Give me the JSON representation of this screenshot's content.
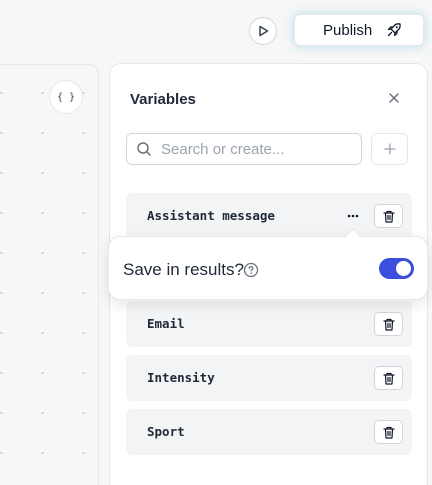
{
  "header": {
    "publish_label": "Publish",
    "play_icon": "play-icon",
    "rocket_icon": "rocket-icon"
  },
  "canvas": {
    "variables_button_glyph": "{ }"
  },
  "panel": {
    "title": "Variables",
    "search": {
      "placeholder": "Search or create...",
      "value": ""
    },
    "add_icon": "plus-icon",
    "close_icon": "close-icon"
  },
  "variables": [
    {
      "name": "Assistant message"
    },
    {
      "name": "Email"
    },
    {
      "name": "Intensity"
    },
    {
      "name": "Sport"
    }
  ],
  "popover": {
    "label": "Save in results?",
    "save_in_results": true
  },
  "colors": {
    "accent": "#3b4fdc",
    "publish_glow": "#78c8dc"
  }
}
